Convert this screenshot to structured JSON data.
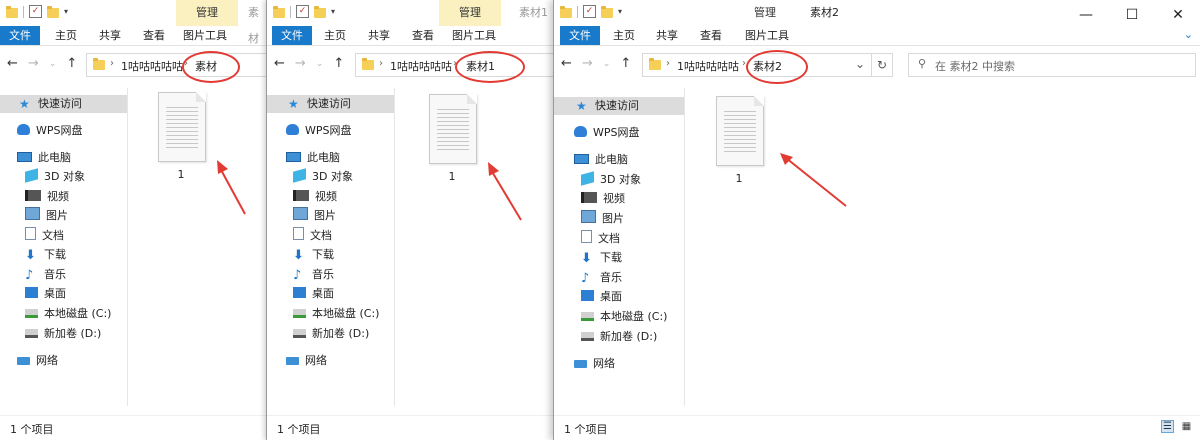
{
  "windows": [
    {
      "id": "w1",
      "context_tab": "管理",
      "title": "素材",
      "tabs": [
        "文件",
        "主页",
        "共享",
        "查看",
        "图片工具"
      ],
      "breadcrumb": [
        "1咕咕咕咕咕",
        "素材"
      ],
      "nav": [
        "快速访问",
        "WPS网盘",
        "此电脑",
        "3D 对象",
        "视频",
        "图片",
        "文档",
        "下载",
        "音乐",
        "桌面",
        "本地磁盘 (C:)",
        "新加卷 (D:)",
        "网络"
      ],
      "file_name": "1",
      "status": "1 个项目"
    },
    {
      "id": "w2",
      "context_tab": "管理",
      "title": "素材1",
      "tabs": [
        "文件",
        "主页",
        "共享",
        "查看",
        "图片工具"
      ],
      "breadcrumb": [
        "1咕咕咕咕咕",
        "素材1"
      ],
      "nav": [
        "快速访问",
        "WPS网盘",
        "此电脑",
        "3D 对象",
        "视频",
        "图片",
        "文档",
        "下载",
        "音乐",
        "桌面",
        "本地磁盘 (C:)",
        "新加卷 (D:)",
        "网络"
      ],
      "file_name": "1",
      "status": "1 个项目"
    },
    {
      "id": "w3",
      "context_tab": "管理",
      "title": "素材2",
      "tabs": [
        "文件",
        "主页",
        "共享",
        "查看",
        "图片工具"
      ],
      "breadcrumb": [
        "1咕咕咕咕咕",
        "素材2"
      ],
      "search_placeholder": "在 素材2 中搜索",
      "nav": [
        "快速访问",
        "WPS网盘",
        "此电脑",
        "3D 对象",
        "视频",
        "图片",
        "文档",
        "下载",
        "音乐",
        "桌面",
        "本地磁盘 (C:)",
        "新加卷 (D:)",
        "网络"
      ],
      "file_name": "1",
      "status": "1 个项目"
    }
  ],
  "colors": {
    "file_tab": "#1979ca",
    "context_tab": "#fbf1c0",
    "annotation_red": "#e23b33",
    "selected_nav": "#dcdcdc"
  }
}
